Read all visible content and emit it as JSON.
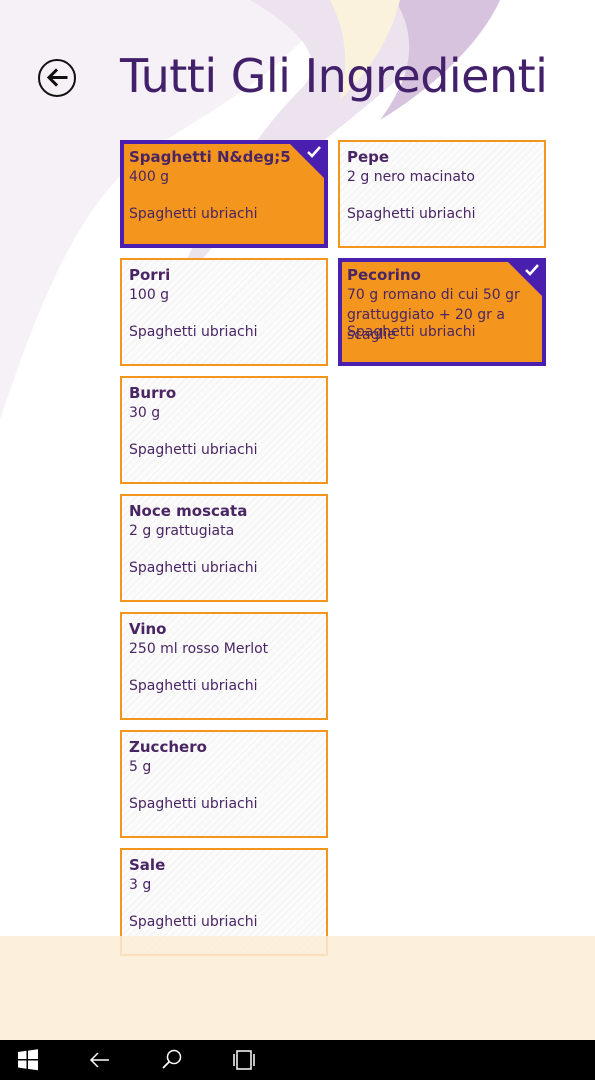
{
  "page": {
    "title": "Tutti Gli Ingredienti",
    "back_label": "back"
  },
  "ingredients": [
    {
      "name": "Spaghetti N&deg;5",
      "qty": "400 g",
      "recipe": "Spaghetti ubriachi",
      "selected": true
    },
    {
      "name": "Pepe",
      "qty": "2 g nero macinato",
      "recipe": "Spaghetti ubriachi",
      "selected": false
    },
    {
      "name": "Porri",
      "qty": "100 g",
      "recipe": "Spaghetti ubriachi",
      "selected": false
    },
    {
      "name": "Pecorino",
      "qty": "70 g romano di cui 50 gr grattuggiato + 20 gr a scaglie",
      "recipe": "Spaghetti ubriachi",
      "selected": true
    },
    {
      "name": "Burro",
      "qty": "30 g",
      "recipe": "Spaghetti ubriachi",
      "selected": false
    },
    {
      "name": "Noce moscata",
      "qty": "2 g grattugiata",
      "recipe": "Spaghetti ubriachi",
      "selected": false
    },
    {
      "name": "Vino",
      "qty": "250 ml rosso Merlot",
      "recipe": "Spaghetti ubriachi",
      "selected": false
    },
    {
      "name": "Zucchero",
      "qty": "5 g",
      "recipe": "Spaghetti ubriachi",
      "selected": false
    },
    {
      "name": "Sale",
      "qty": "3 g",
      "recipe": "Spaghetti ubriachi",
      "selected": false
    }
  ],
  "colors": {
    "accent": "#f4961e",
    "selected_border": "#4a1fb0",
    "title": "#42206a",
    "text": "#4a2564"
  },
  "taskbar": {
    "icons": [
      "windows-start-icon",
      "back-arrow-icon",
      "search-icon",
      "task-view-icon"
    ]
  }
}
